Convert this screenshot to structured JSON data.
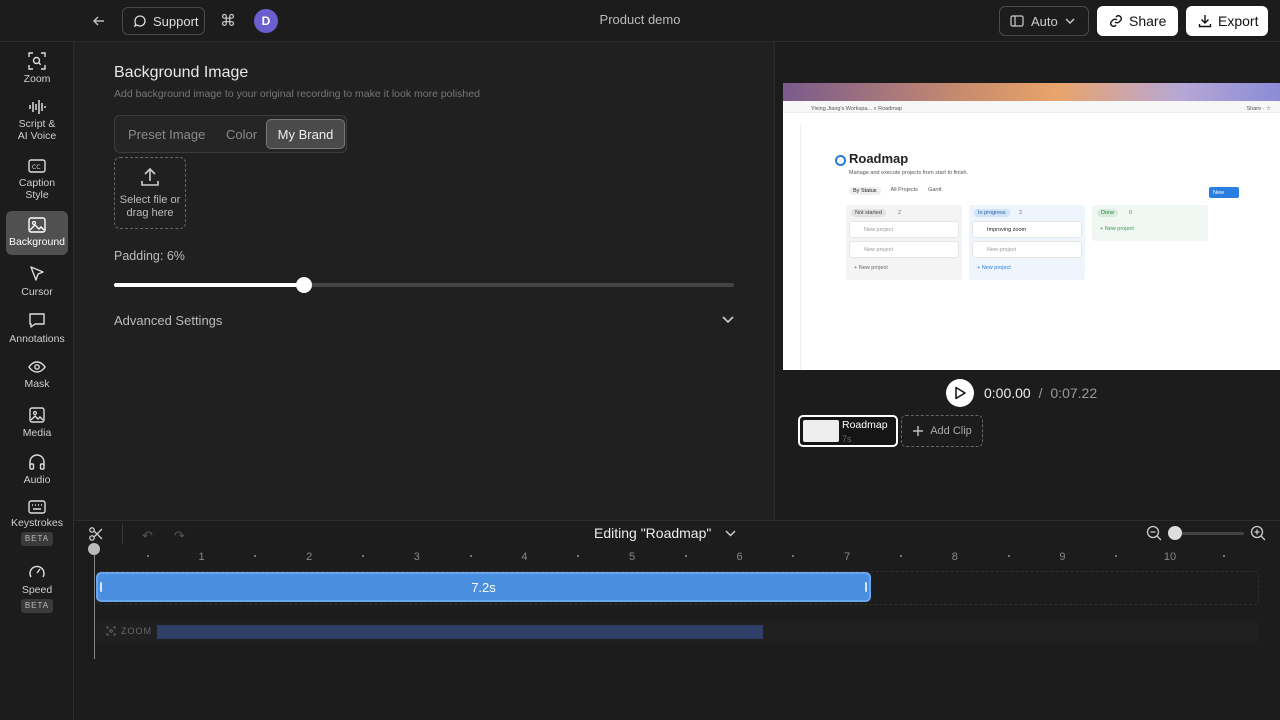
{
  "topbar": {
    "support_label": "Support",
    "cmd_glyph": "⌘",
    "avatar_initial": "D",
    "project_title": "Product demo",
    "aspect_label": "Auto",
    "share_label": "Share",
    "export_label": "Export"
  },
  "sidebar": {
    "items": [
      {
        "label": "Zoom",
        "icon": "zoom-icon"
      },
      {
        "label": "Script &",
        "label2": "AI Voice",
        "icon": "waveform-icon"
      },
      {
        "label": "Caption",
        "label2": "Style",
        "icon": "caption-icon"
      },
      {
        "label": "Background",
        "icon": "image-icon",
        "active": true
      },
      {
        "label": "Cursor",
        "icon": "cursor-icon"
      },
      {
        "label": "Annotations",
        "icon": "comment-icon"
      },
      {
        "label": "Mask",
        "icon": "eye-icon"
      },
      {
        "label": "Media",
        "icon": "media-icon"
      },
      {
        "label": "Audio",
        "icon": "headphones-icon"
      },
      {
        "label": "Keystrokes",
        "icon": "keyboard-icon",
        "badge": "BETA"
      },
      {
        "label": "Speed",
        "icon": "gauge-icon",
        "badge": "BETA"
      }
    ]
  },
  "panel": {
    "title": "Background Image",
    "description": "Add background image to your original recording to make it look more polished",
    "tabs": [
      "Preset Image",
      "Color",
      "My Brand"
    ],
    "active_tab": "My Brand",
    "upload_text_1": "Select file or",
    "upload_text_2": "drag here",
    "padding_label": "Padding: 6%",
    "padding_fraction": 0.306,
    "advanced_label": "Advanced Settings"
  },
  "preview": {
    "page": {
      "breadcrumb_left": "Yixing Jiang's Workspa...   ⌕ Roadmap",
      "breadcrumb_right": "Share ·  ☆",
      "title": "Roadmap",
      "subtitle": "Manage and execute projects from start to finish.",
      "views": [
        "By Status",
        "All Projects",
        "Gantt"
      ],
      "new_button": "New",
      "columns": [
        {
          "name": "Not started",
          "count": "2",
          "cards": [
            "New project",
            "New project"
          ],
          "add": "+ New project"
        },
        {
          "name": "In progress",
          "count": "2",
          "cards": [
            "Improving zoom",
            "New project"
          ],
          "add": "+ New project"
        },
        {
          "name": "Done",
          "count": "0",
          "cards": [],
          "add": "+ New project"
        }
      ]
    },
    "current_time": "0:00.00",
    "time_sep": "/",
    "total_time": "0:07.22",
    "clip_name": "Roadmap",
    "clip_duration": "7s",
    "add_clip_label": "Add Clip"
  },
  "timeline": {
    "editing_label": "Editing \"Roadmap\"",
    "ticks": [
      "1",
      "2",
      "3",
      "4",
      "5",
      "6",
      "7",
      "8",
      "9",
      "10"
    ],
    "segment_label": "7.2s",
    "segment_seconds": 7.2,
    "zoom_label": "ZOOM"
  },
  "colors": {
    "accent_blue": "#4a8ee0",
    "avatar_purple": "#6b5fd0",
    "zoom_bar": "#2e3e66"
  }
}
